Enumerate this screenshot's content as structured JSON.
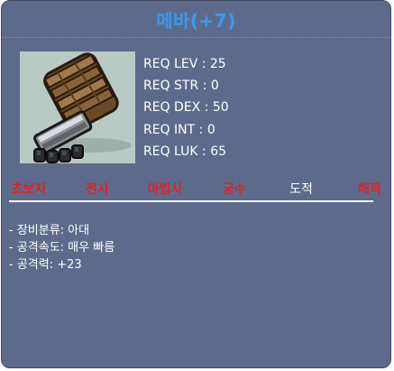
{
  "item": {
    "title": "메바(+7)"
  },
  "requirements": [
    "REQ LEV : 25",
    "REQ STR : 0",
    "REQ DEX : 50",
    "REQ INT : 0",
    "REQ LUK : 65"
  ],
  "jobs": [
    {
      "label": "초보자",
      "available": false
    },
    {
      "label": "전사",
      "available": false
    },
    {
      "label": "마법사",
      "available": false
    },
    {
      "label": "궁수",
      "available": false
    },
    {
      "label": "도적",
      "available": true
    },
    {
      "label": "해적",
      "available": false
    }
  ],
  "stats": [
    "- 장비분류: 아대",
    "- 공격속도: 매우 빠름",
    "- 공격력: +23"
  ],
  "colors": {
    "panel": "#5c6b8c",
    "title": "#3d98ea",
    "unavailable_job": "#e61e20",
    "available_job": "#ffffff"
  },
  "icon": "claw-glove-icon"
}
